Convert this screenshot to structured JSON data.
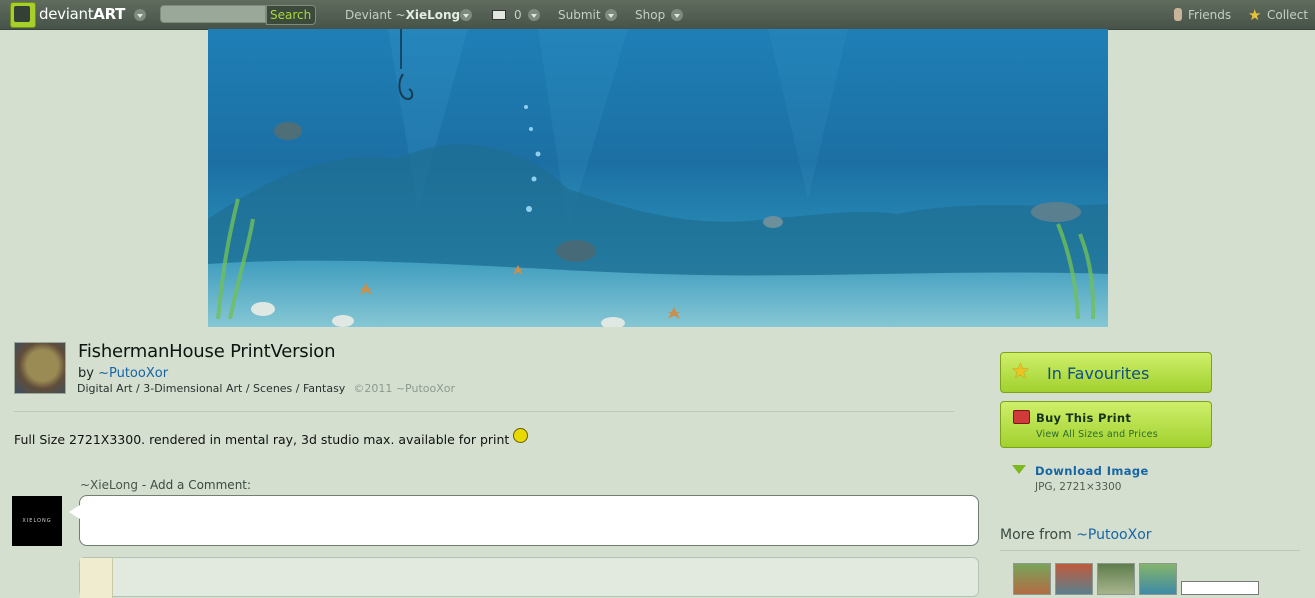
{
  "topbar": {
    "logo_plain": "deviant",
    "logo_bold": "ART",
    "search_placeholder": "",
    "search_button": "Search",
    "deviant_prefix": "Deviant ~",
    "deviant_name": "XieLong",
    "mail_count": "0",
    "submit": "Submit",
    "shop": "Shop",
    "friends": "Friends",
    "collect": "Collect"
  },
  "deviation": {
    "title": "FishermanHouse PrintVersion",
    "by_label": "by",
    "author": "~PutooXor",
    "category": "Digital Art / 3-Dimensional Art / Scenes / Fantasy",
    "copyright": "©2011 ~PutooXor",
    "description": "Full Size 2721X3300. rendered in mental ray, 3d studio max. available for print"
  },
  "comment": {
    "user": "~XieLong",
    "prompt": " - Add a Comment:",
    "avatar_text": "XIELONG"
  },
  "sidebar": {
    "favourites": "In Favourites",
    "buy_print": "Buy This Print",
    "buy_print_sub": "View All Sizes and Prices",
    "download": "Download Image",
    "download_meta": "JPG, 2721×3300",
    "more_from_label": "More from",
    "more_from_author": "~PutooXor"
  },
  "icons": {
    "logo": "deviantart-logo-icon",
    "mail": "mail-icon",
    "friends": "friends-icon",
    "collect": "star-icon",
    "favourite": "star-icon",
    "print": "print-icon",
    "download": "download-arrow-icon",
    "smiley": "smiley-icon"
  },
  "colors": {
    "background": "#d4dfd0",
    "topbar": "#4f5c50",
    "link": "#1665a4",
    "button_green": "#b5de48"
  }
}
